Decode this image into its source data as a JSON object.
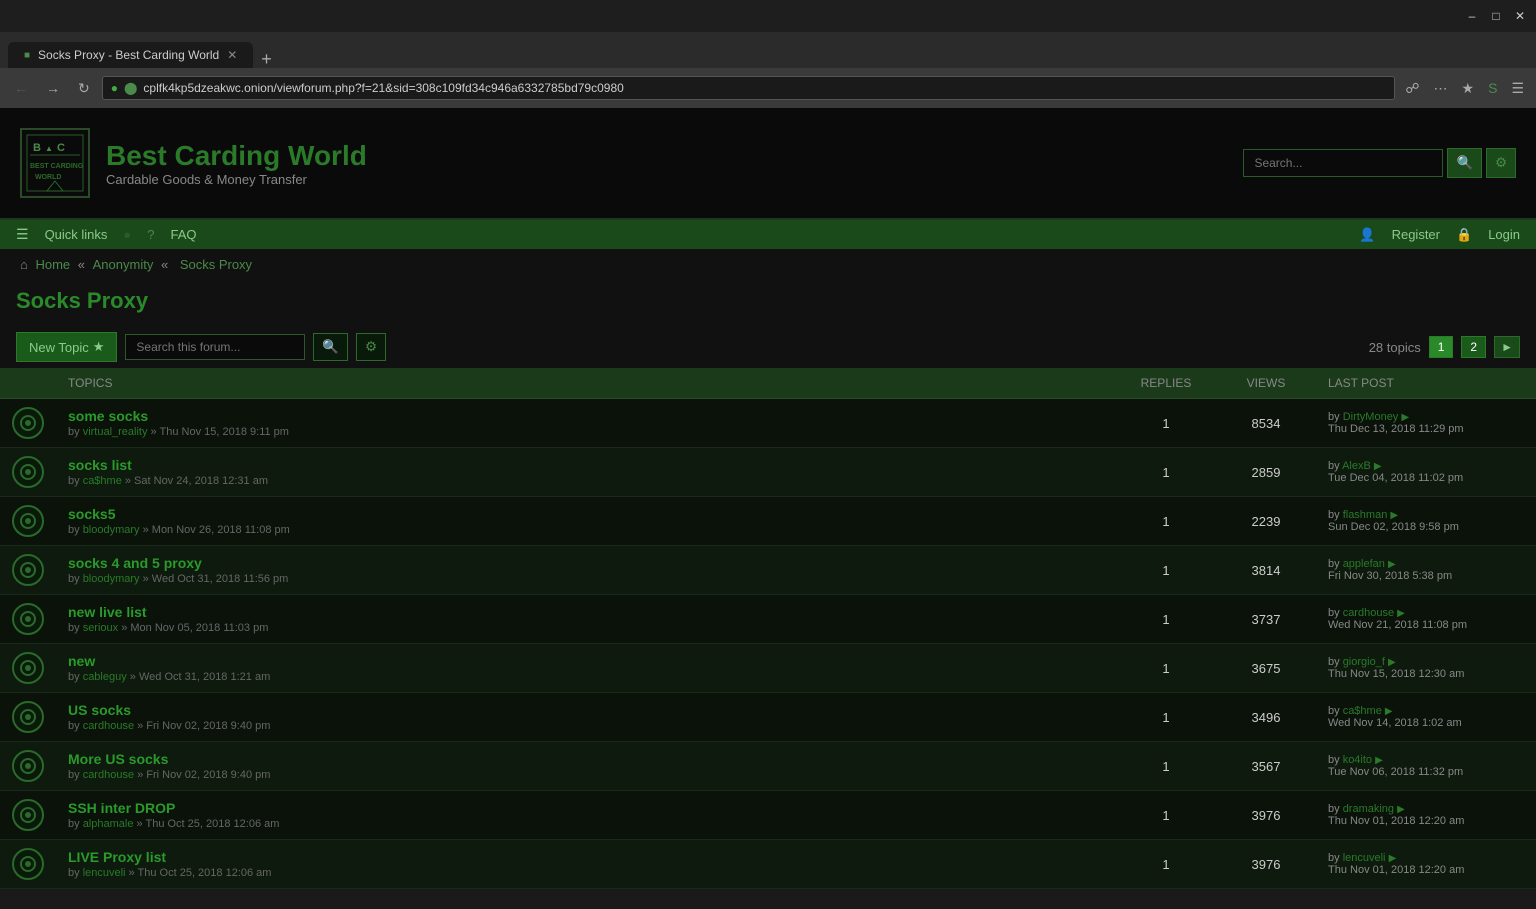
{
  "browser": {
    "tab_title": "Socks Proxy - Best Carding World",
    "url": "cplfk4kp5dzeakwc.onion/viewforum.php?f=21&sid=308c109fd34c946a6332785bd79c0980",
    "new_tab_label": "+"
  },
  "site": {
    "title": "Best Carding World",
    "subtitle": "Cardable Goods & Money Transfer",
    "logo_text": "BCW",
    "search_placeholder": "Search..."
  },
  "nav": {
    "quick_links": "Quick links",
    "faq": "FAQ",
    "register": "Register",
    "login": "Login"
  },
  "breadcrumb": {
    "home": "Home",
    "anonymity": "Anonymity",
    "current": "Socks Proxy"
  },
  "forum": {
    "title": "Socks Proxy",
    "new_topic_label": "New Topic",
    "search_placeholder": "Search this forum...",
    "topics_count": "28 topics",
    "pages": [
      "1",
      "2"
    ],
    "columns": {
      "topics": "TOPICS",
      "replies": "REPLIES",
      "views": "VIEWS",
      "last_post": "LAST POST"
    }
  },
  "topics": [
    {
      "title": "some socks",
      "author": "virtual_reality",
      "date": "Thu Nov 15, 2018 9:11 pm",
      "replies": "1",
      "views": "8534",
      "last_by": "DirtyMoney",
      "last_date": "Thu Dec 13, 2018 11:29 pm"
    },
    {
      "title": "socks list",
      "author": "ca$hme",
      "date": "Sat Nov 24, 2018 12:31 am",
      "replies": "1",
      "views": "2859",
      "last_by": "AlexB",
      "last_date": "Tue Dec 04, 2018 11:02 pm"
    },
    {
      "title": "socks5",
      "author": "bloodymary",
      "date": "Mon Nov 26, 2018 11:08 pm",
      "replies": "1",
      "views": "2239",
      "last_by": "flashman",
      "last_date": "Sun Dec 02, 2018 9:58 pm"
    },
    {
      "title": "socks 4 and 5 proxy",
      "author": "bloodymary",
      "date": "Wed Oct 31, 2018 11:56 pm",
      "replies": "1",
      "views": "3814",
      "last_by": "applefan",
      "last_date": "Fri Nov 30, 2018 5:38 pm"
    },
    {
      "title": "new live list",
      "author": "serioux",
      "date": "Mon Nov 05, 2018 11:03 pm",
      "replies": "1",
      "views": "3737",
      "last_by": "cardhouse",
      "last_date": "Wed Nov 21, 2018 11:08 pm"
    },
    {
      "title": "new",
      "author": "cableguy",
      "date": "Wed Oct 31, 2018 1:21 am",
      "replies": "1",
      "views": "3675",
      "last_by": "giorgio_f",
      "last_date": "Thu Nov 15, 2018 12:30 am"
    },
    {
      "title": "US socks",
      "author": "cardhouse",
      "date": "Fri Nov 02, 2018 9:40 pm",
      "replies": "1",
      "views": "3496",
      "last_by": "ca$hme",
      "last_date": "Wed Nov 14, 2018 1:02 am"
    },
    {
      "title": "More US socks",
      "author": "cardhouse",
      "date": "Fri Nov 02, 2018 9:40 pm",
      "replies": "1",
      "views": "3567",
      "last_by": "ko4ito",
      "last_date": "Tue Nov 06, 2018 11:32 pm"
    },
    {
      "title": "SSH inter DROP",
      "author": "alphamale",
      "date": "Thu Oct 25, 2018 12:06 am",
      "replies": "1",
      "views": "3976",
      "last_by": "dramaking",
      "last_date": "Thu Nov 01, 2018 12:20 am"
    },
    {
      "title": "LIVE Proxy list",
      "author": "lencuveli",
      "date": "Thu Oct 25, 2018 12:06 am",
      "replies": "1",
      "views": "3976",
      "last_by": "lencuveli",
      "last_date": "Thu Nov 01, 2018 12:20 am"
    }
  ]
}
